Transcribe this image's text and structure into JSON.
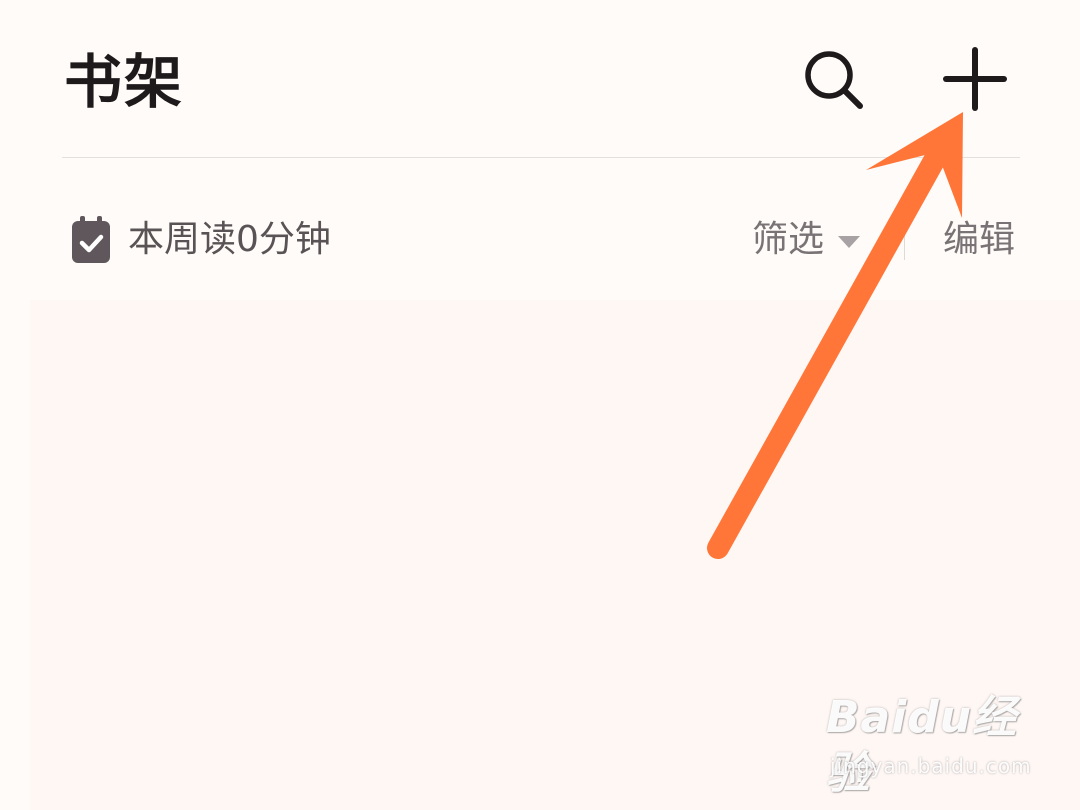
{
  "header": {
    "title": "书架",
    "search_icon": "search-icon",
    "add_icon": "plus-icon"
  },
  "toolbar": {
    "reading_icon": "calendar-check-icon",
    "reading_time": "本周读0分钟",
    "filter_label": "筛选",
    "filter_icon": "caret-down-icon",
    "edit_label": "编辑"
  },
  "annotation": {
    "arrow_color": "#ff7638",
    "arrow_target": "add-button"
  },
  "watermark": {
    "logo_text": "Baidu经验",
    "url": "jingyan.baidu.com"
  },
  "colors": {
    "background": "#fffbf8",
    "title": "#1e1a1c",
    "secondary_text": "#7a7376",
    "divider": "#e6e0dd"
  }
}
